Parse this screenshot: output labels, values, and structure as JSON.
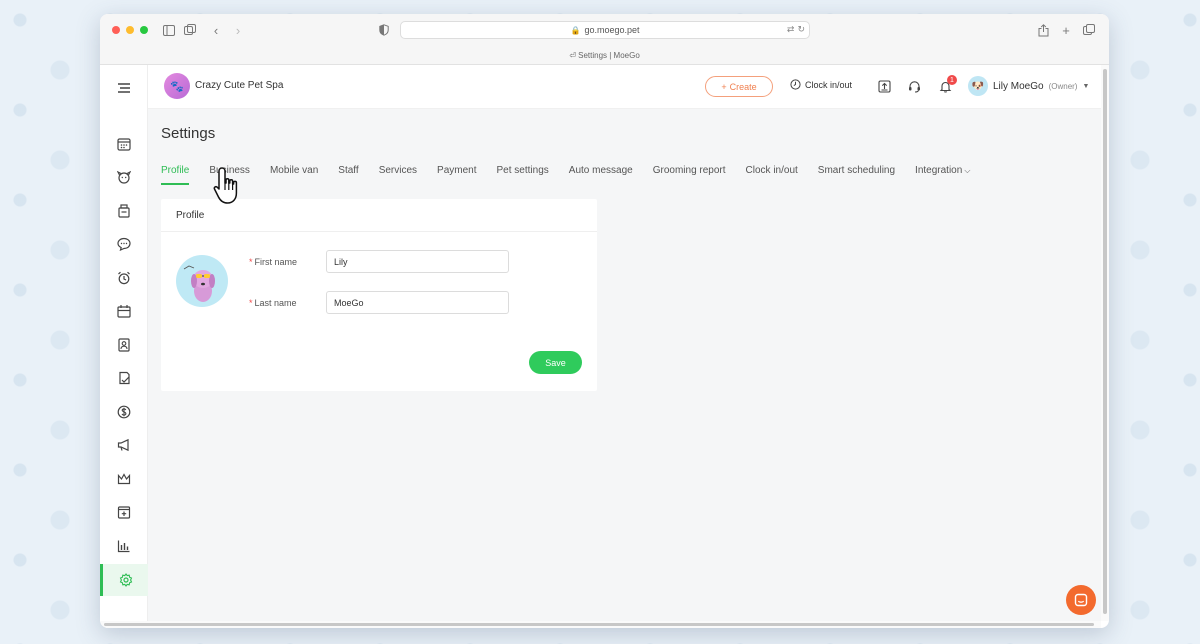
{
  "browser": {
    "url": "go.moego.pet",
    "tab_title": "Settings | MoeGo"
  },
  "header": {
    "business_name": "Crazy Cute Pet Spa",
    "create_label": "Create",
    "clock_label": "Clock in/out",
    "notification_count": "1",
    "user_name": "Lily MoeGo",
    "user_role": "(Owner)"
  },
  "sidebar": {
    "items": [
      {
        "icon": "calendar-icon"
      },
      {
        "icon": "pet-icon"
      },
      {
        "icon": "store-icon"
      },
      {
        "icon": "message-icon"
      },
      {
        "icon": "alarm-icon"
      },
      {
        "icon": "schedule-icon"
      },
      {
        "icon": "client-card-icon"
      },
      {
        "icon": "review-icon"
      },
      {
        "icon": "dollar-icon"
      },
      {
        "icon": "megaphone-icon"
      },
      {
        "icon": "crown-icon"
      },
      {
        "icon": "add-calendar-icon"
      },
      {
        "icon": "chart-icon"
      },
      {
        "icon": "gear-icon"
      }
    ],
    "active_index": 13
  },
  "page": {
    "title": "Settings",
    "tabs": [
      {
        "label": "Profile"
      },
      {
        "label": "Business"
      },
      {
        "label": "Mobile van"
      },
      {
        "label": "Staff"
      },
      {
        "label": "Services"
      },
      {
        "label": "Payment"
      },
      {
        "label": "Pet settings"
      },
      {
        "label": "Auto message"
      },
      {
        "label": "Grooming report"
      },
      {
        "label": "Clock in/out"
      },
      {
        "label": "Smart scheduling"
      },
      {
        "label": "Integration"
      }
    ]
  },
  "profile": {
    "card_title": "Profile",
    "first_name_label": "First name",
    "first_name_value": "Lily",
    "last_name_label": "Last name",
    "last_name_value": "MoeGo",
    "save_label": "Save"
  },
  "colors": {
    "accent_green": "#2fbd55",
    "create_orange": "#f08050",
    "chat_orange": "#f36a2e"
  }
}
